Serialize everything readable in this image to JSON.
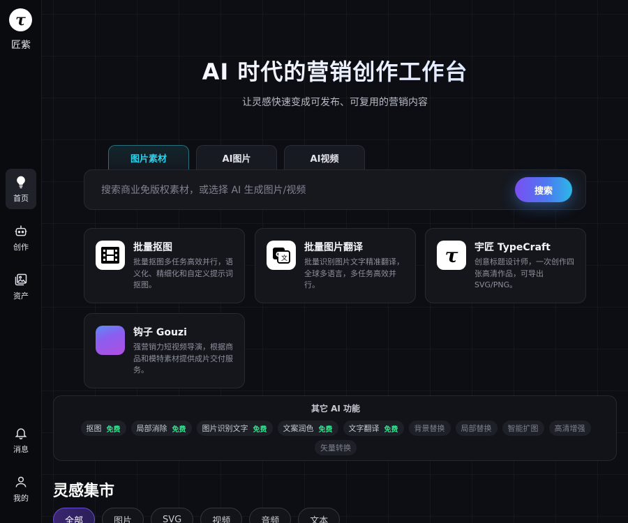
{
  "app": {
    "logo_glyph": "τ",
    "logo_text": "匠紫"
  },
  "sidebar": {
    "items": [
      {
        "label": "首页",
        "icon": "lightbulb-icon",
        "active": true
      },
      {
        "label": "创作",
        "icon": "robot-icon",
        "active": false
      },
      {
        "label": "资产",
        "icon": "image-stack-icon",
        "active": false
      },
      {
        "label": "消息",
        "icon": "bell-icon",
        "active": false
      },
      {
        "label": "我的",
        "icon": "user-icon",
        "active": false
      }
    ]
  },
  "hero": {
    "title": "AI 时代的营销创作工作台",
    "subtitle": "让灵感快速变成可发布、可复用的营销内容"
  },
  "tabs": [
    "图片素材",
    "AI图片",
    "AI视频"
  ],
  "search": {
    "placeholder": "搜索商业免版权素材，或选择 AI 生成图片/视频",
    "value": "",
    "button_label": "搜索"
  },
  "cards": [
    {
      "title": "批量抠图",
      "desc": "批量抠图多任务高效并行，语义化、精细化和自定义提示词抠图。",
      "icon": "film-frame-icon"
    },
    {
      "title": "批量图片翻译",
      "desc": "批量识别图片文字精准翻译，全球多语言，多任务高效并行。",
      "icon": "translate-icon"
    },
    {
      "title": "宇匠 TypeCraft",
      "desc": "创意标题设计师，一次创作四张高清作品，可导出SVG/PNG。",
      "icon": "typecraft-logo-icon"
    },
    {
      "title": "钩子 Gouzi",
      "desc": "强营销力短视频导演，根据商品和模特素材提供成片交付服务。",
      "icon": "gouzi-gradient-icon"
    }
  ],
  "other_features": {
    "title": "其它 AI 功能",
    "free_label": "免费",
    "items": [
      {
        "label": "抠图",
        "free": true
      },
      {
        "label": "局部消除",
        "free": true
      },
      {
        "label": "图片识别文字",
        "free": true
      },
      {
        "label": "文案润色",
        "free": true
      },
      {
        "label": "文字翻译",
        "free": true
      },
      {
        "label": "背景替换",
        "free": false
      },
      {
        "label": "局部替换",
        "free": false
      },
      {
        "label": "智能扩图",
        "free": false
      },
      {
        "label": "高清增强",
        "free": false
      },
      {
        "label": "矢量转换",
        "free": false
      }
    ]
  },
  "market": {
    "title": "灵感集市",
    "categories": [
      "全部",
      "图片",
      "SVG",
      "视频",
      "音频",
      "文本"
    ]
  },
  "colors": {
    "accent_cyan": "#29d3ec",
    "accent_purple": "#7a4ff0",
    "free_green": "#2fe08b",
    "background": "#0d0e13"
  }
}
